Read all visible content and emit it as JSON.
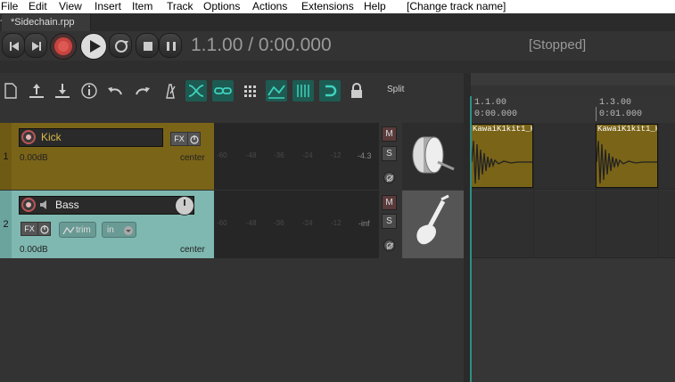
{
  "menu": [
    "File",
    "Edit",
    "View",
    "Insert",
    "Item",
    "Track",
    "Options",
    "Actions",
    "Extensions",
    "Help",
    "[Change track name]"
  ],
  "tab": {
    "title": "*Sidechain.rpp",
    "add": "+"
  },
  "transport": {
    "time": "1.1.00 / 0:00.000",
    "state": "[Stopped]"
  },
  "toolbar": {
    "split_label": "Split"
  },
  "tracks": [
    {
      "number": "1",
      "name": "Kick",
      "volume": "0.00dB",
      "pan": "center",
      "peak": "-4.3",
      "mute": "M",
      "solo": "S",
      "fx": "FX",
      "color": "#7a6418"
    },
    {
      "number": "2",
      "name": "Bass",
      "volume": "0.00dB",
      "pan": "center",
      "peak": "-inf",
      "mute": "M",
      "solo": "S",
      "fx": "FX",
      "trim": "trim",
      "input": "in",
      "color": "#7fb8b0"
    }
  ],
  "meter_scale": [
    "-60",
    "-48",
    "-36",
    "-24",
    "-12"
  ],
  "ruler": [
    {
      "bar": "1.1.00",
      "time": "0:00.000"
    },
    {
      "bar": "1.3.00",
      "time": "0:01.000"
    }
  ],
  "items": [
    {
      "label": "KawaiK1kit1_K"
    },
    {
      "label": "KawaiK1kit1_K"
    }
  ]
}
